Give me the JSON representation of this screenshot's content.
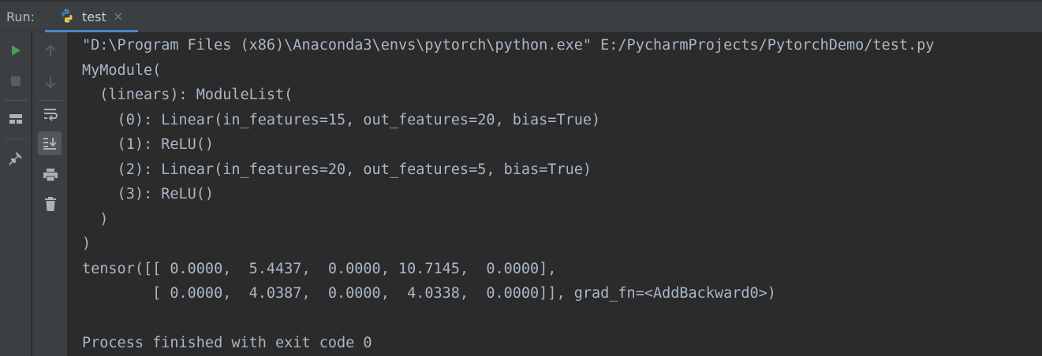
{
  "header": {
    "run_label": "Run:",
    "tab": {
      "label": "test",
      "close_glyph": "×",
      "icon": "python-icon"
    }
  },
  "left_toolbar": [
    {
      "name": "rerun-icon",
      "color": "#499c54"
    },
    {
      "name": "stop-icon",
      "color": "#5a5d60"
    },
    {
      "name": "layout-icon",
      "color": "#afb1b3"
    },
    {
      "name": "pin-icon",
      "color": "#afb1b3"
    }
  ],
  "mid_toolbar": [
    {
      "name": "arrow-up-icon"
    },
    {
      "name": "arrow-down-icon"
    },
    {
      "name": "soft-wrap-icon"
    },
    {
      "name": "scroll-to-end-icon"
    },
    {
      "name": "print-icon"
    },
    {
      "name": "trash-icon"
    }
  ],
  "console": {
    "lines": [
      "\"D:\\Program Files (x86)\\Anaconda3\\envs\\pytorch\\python.exe\" E:/PycharmProjects/PytorchDemo/test.py",
      "MyModule(",
      "  (linears): ModuleList(",
      "    (0): Linear(in_features=15, out_features=20, bias=True)",
      "    (1): ReLU()",
      "    (2): Linear(in_features=20, out_features=5, bias=True)",
      "    (3): ReLU()",
      "  )",
      ")",
      "tensor([[ 0.0000,  5.4437,  0.0000, 10.7145,  0.0000],",
      "        [ 0.0000,  4.0387,  0.0000,  4.0338,  0.0000]], grad_fn=<AddBackward0>)",
      "",
      "Process finished with exit code 0"
    ]
  },
  "colors": {
    "background": "#2b2b2b",
    "panel": "#3c3f41",
    "text": "#a9b7c6",
    "accent": "#4a88c7",
    "run_green": "#499c54"
  }
}
